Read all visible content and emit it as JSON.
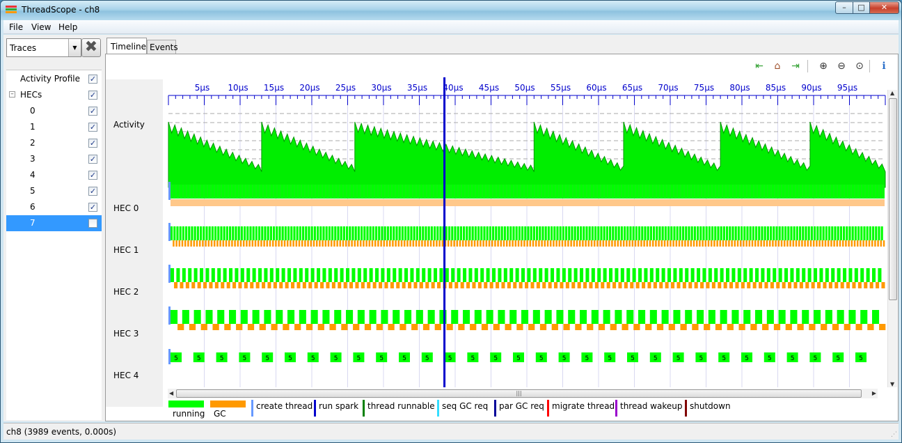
{
  "window": {
    "title": "ThreadScope - ch8",
    "minimize": "–",
    "maximize": "□",
    "close": "✕"
  },
  "menu": [
    "File",
    "View",
    "Help"
  ],
  "traces": {
    "combo_value": "Traces",
    "remove_glyph": "✖",
    "items": [
      {
        "label": "Activity Profile",
        "checked": true
      },
      {
        "label": "HECs",
        "checked": true,
        "expander": "–"
      },
      {
        "label": "0",
        "checked": true
      },
      {
        "label": "1",
        "checked": true
      },
      {
        "label": "2",
        "checked": true
      },
      {
        "label": "3",
        "checked": true
      },
      {
        "label": "4",
        "checked": true
      },
      {
        "label": "5",
        "checked": true
      },
      {
        "label": "6",
        "checked": true
      },
      {
        "label": "7",
        "checked": false,
        "selected": true
      }
    ]
  },
  "tabs": {
    "timeline": "Timeline",
    "events": "Events"
  },
  "toolbar": {
    "icons": [
      "jump-start-icon",
      "home-icon",
      "jump-end-icon",
      "zoom-in-icon",
      "zoom-out-icon",
      "zoom-fit-icon",
      "info-icon"
    ],
    "glyphs": [
      "⇤",
      "⌂",
      "⇥",
      "⊕",
      "⊖",
      "⊙",
      "ℹ"
    ]
  },
  "rows": {
    "activity": "Activity",
    "hecs": [
      "HEC 0",
      "HEC 1",
      "HEC 2",
      "HEC 3",
      "HEC 4"
    ]
  },
  "timeline": {
    "ticks": [
      "5μs",
      "10μs",
      "15μs",
      "20μs",
      "25μs",
      "30μs",
      "35μs",
      "40μs",
      "45μs",
      "50μs",
      "55μs",
      "60μs",
      "65μs",
      "70μs",
      "75μs",
      "80μs",
      "85μs",
      "90μs",
      "95μs"
    ],
    "cursor_us": 38.5,
    "visible_range_us": [
      0,
      100
    ],
    "hec4_thread_label": "5",
    "colors": {
      "running": "#00ff00",
      "gc": "#ff9900",
      "gc_light": "#ffc88a",
      "cursor": "#0000cc",
      "axis": "#0000cc",
      "activity": "#00ee00"
    }
  },
  "legend": {
    "bars": [
      {
        "label": "running",
        "color": "#00ff00"
      },
      {
        "label": "GC",
        "color": "#ff9900"
      }
    ],
    "lines": [
      {
        "label": "create thread",
        "color": "#6699ff"
      },
      {
        "label": "run spark",
        "color": "#0000cc"
      },
      {
        "label": "thread runnable",
        "color": "#008000"
      },
      {
        "label": "seq GC req",
        "color": "#33ddff"
      },
      {
        "label": "par GC req",
        "color": "#000099"
      },
      {
        "label": "migrate thread",
        "color": "#ff0000"
      },
      {
        "label": "thread wakeup",
        "color": "#9900cc"
      },
      {
        "label": "shutdown",
        "color": "#800000"
      }
    ]
  },
  "status": "ch8 (3989 events, 0.000s)",
  "colors": {
    "selection": "#3399ff"
  }
}
